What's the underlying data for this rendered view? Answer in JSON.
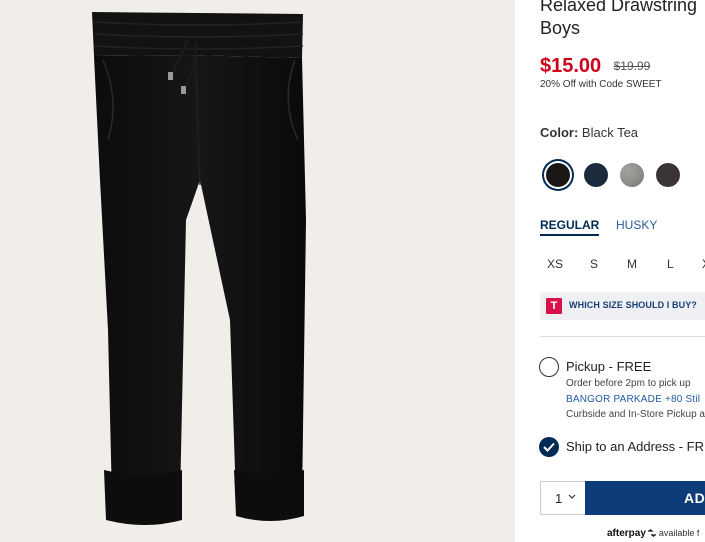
{
  "product": {
    "title_line1": "Relaxed Drawstring",
    "title_line2": "Boys",
    "price_now": "$15.00",
    "price_was": "$19.99",
    "promo": "20% Off with Code SWEET"
  },
  "color": {
    "label": "Color:",
    "selected_name": "Black Tea",
    "swatches": [
      {
        "name": "black",
        "color": "#1a1717",
        "selected": true
      },
      {
        "name": "navy",
        "color": "#1b2a3d",
        "selected": false
      },
      {
        "name": "heather-grey",
        "color": "#8b8b88",
        "selected": false
      },
      {
        "name": "charcoal",
        "color": "#3a3435",
        "selected": false
      }
    ]
  },
  "fit": {
    "tabs": [
      "REGULAR",
      "HUSKY"
    ],
    "active": "REGULAR"
  },
  "sizes": [
    "XS",
    "S",
    "M",
    "L",
    "X"
  ],
  "size_help": {
    "icon_letter": "T",
    "label": "WHICH SIZE SHOULD I BUY?"
  },
  "fulfillment": {
    "pickup_label": "Pickup - FREE",
    "pickup_line1": "Order before 2pm to pick up",
    "pickup_store": "BANGOR PARKADE +80 Stil",
    "pickup_line3": "Curbside and In-Store Pickup a",
    "ship_label": "Ship to an Address - FR"
  },
  "cart": {
    "quantity": "1",
    "add_label": "AD"
  },
  "afterpay": {
    "brand": "afterpay",
    "text": "available f"
  },
  "colors": {
    "price_red": "#d0021b",
    "navy": "#002b55",
    "button_blue": "#0e3c78",
    "image_bg": "#f1eee9"
  }
}
